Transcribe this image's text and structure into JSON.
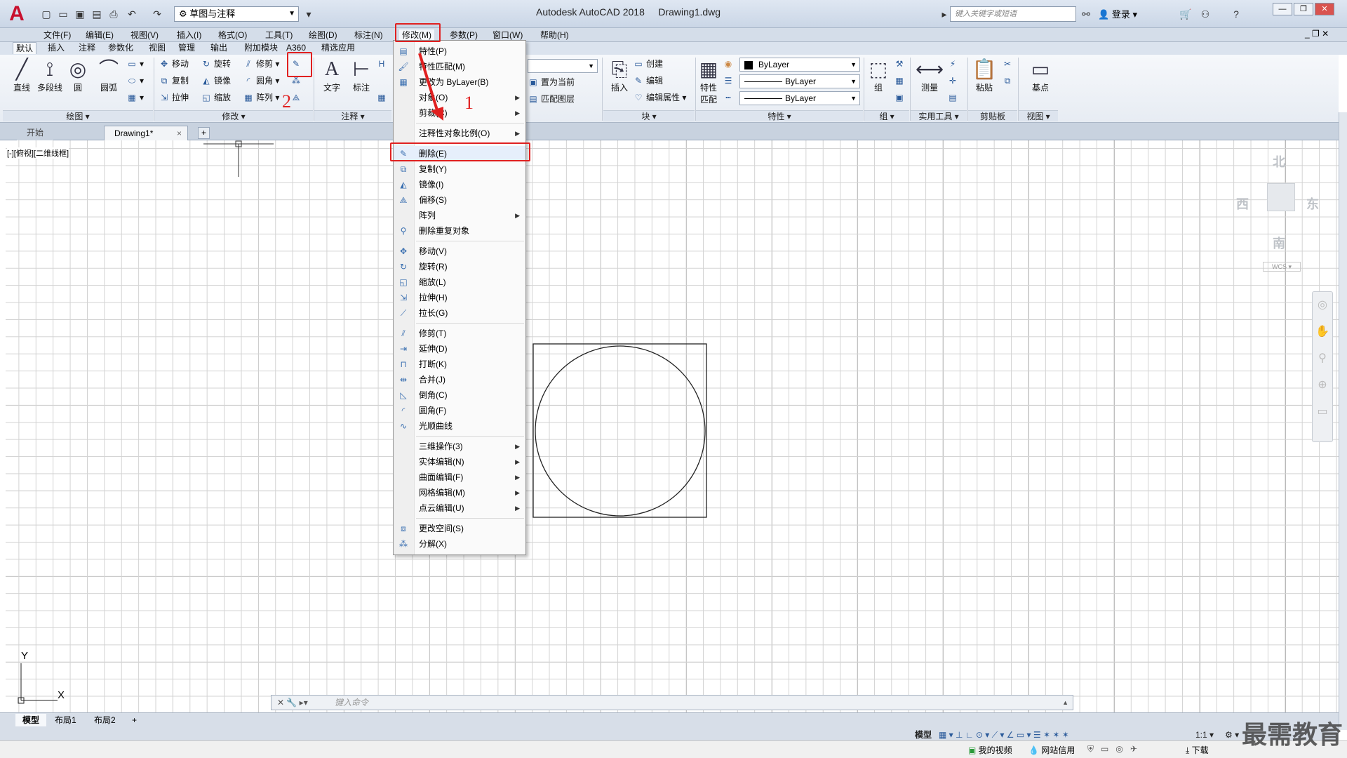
{
  "app": {
    "title": "Autodesk AutoCAD 2018",
    "document": "Drawing1.dwg",
    "logo": "A",
    "workspace": "草图与注释",
    "search_placeholder": "键入关键字或短语",
    "login": "登录"
  },
  "menubar": [
    "文件(F)",
    "编辑(E)",
    "视图(V)",
    "插入(I)",
    "格式(O)",
    "工具(T)",
    "绘图(D)",
    "标注(N)",
    "修改(M)",
    "参数(P)",
    "窗口(W)",
    "帮助(H)"
  ],
  "ribbon_tabs": [
    "默认",
    "插入",
    "注释",
    "参数化",
    "视图",
    "管理",
    "输出",
    "附加模块",
    "A360",
    "精选应用"
  ],
  "ribbon": {
    "draw": {
      "title": "绘图",
      "line": "直线",
      "polyline": "多段线",
      "circle": "圆",
      "arc": "圆弧"
    },
    "modify": {
      "title": "修改",
      "move": "移动",
      "rotate": "旋转",
      "trim": "修剪",
      "copy": "复制",
      "mirror": "镜像",
      "fillet": "圆角",
      "stretch": "拉伸",
      "scale": "缩放",
      "array": "阵列"
    },
    "annotation": {
      "title": "注释",
      "text": "文字",
      "dimension": "标注"
    },
    "layer": {
      "set_current": "置为当前",
      "match_layer": "匹配图层"
    },
    "block": {
      "title": "块",
      "insert": "插入",
      "create": "创建",
      "edit": "编辑",
      "edit_attr": "编辑属性"
    },
    "properties": {
      "title": "特性",
      "match": "特性匹配",
      "match_l1": "特性",
      "match_l2": "匹配",
      "color": "ByLayer",
      "linetype": "ByLayer",
      "lineweight": "ByLayer"
    },
    "group": {
      "title": "组",
      "group": "组"
    },
    "utilities": {
      "title": "实用工具",
      "measure": "测量"
    },
    "clipboard": {
      "title": "剪贴板",
      "paste": "粘贴"
    },
    "view": {
      "title": "视图",
      "base": "基点"
    }
  },
  "doctabs": {
    "start": "开始",
    "drawing": "Drawing1*",
    "close": "×",
    "add": "+"
  },
  "viewport_label": "[-][俯视][二维线框]",
  "viewcube": {
    "north": "北",
    "south": "南",
    "east": "东",
    "west": "西",
    "wcs": "WCS"
  },
  "ucs": {
    "x": "X",
    "y": "Y"
  },
  "command_placeholder": "键入命令",
  "layout_tabs": [
    "模型",
    "布局1",
    "布局2"
  ],
  "status": {
    "model": "模型",
    "scale": "1:1"
  },
  "taskbar": {
    "video": "我的视频",
    "credit": "网站信用",
    "download": "下载"
  },
  "watermark": "最需教育",
  "annotations": {
    "step1": "1",
    "step2": "2"
  },
  "dropdown": [
    {
      "label": "特性(P)",
      "icon": "properties-icon",
      "glyph": "▤"
    },
    {
      "label": "特性匹配(M)",
      "icon": "match-properties-icon",
      "glyph": "🖌"
    },
    {
      "label": "更改为 ByLayer(B)",
      "icon": "bylayer-icon",
      "glyph": "▦"
    },
    {
      "label": "对象(O)",
      "sub": true
    },
    {
      "label": "剪裁(C)",
      "sub": true
    },
    {
      "sep": true
    },
    {
      "label": "注释性对象比例(O)",
      "sub": true
    },
    {
      "sep": true
    },
    {
      "label": "删除(E)",
      "icon": "erase-icon",
      "glyph": "✎",
      "highlight": true
    },
    {
      "label": "复制(Y)",
      "icon": "copy-icon",
      "glyph": "⧉"
    },
    {
      "label": "镜像(I)",
      "icon": "mirror-icon",
      "glyph": "◭"
    },
    {
      "label": "偏移(S)",
      "icon": "offset-icon",
      "glyph": "⟁"
    },
    {
      "label": "阵列",
      "sub": true
    },
    {
      "label": "删除重复对象",
      "icon": "overkill-icon",
      "glyph": "⚲"
    },
    {
      "sep": true
    },
    {
      "label": "移动(V)",
      "icon": "move-icon",
      "glyph": "✥"
    },
    {
      "label": "旋转(R)",
      "icon": "rotate-icon",
      "glyph": "↻"
    },
    {
      "label": "缩放(L)",
      "icon": "scale-icon",
      "glyph": "◱"
    },
    {
      "label": "拉伸(H)",
      "icon": "stretch-icon",
      "glyph": "⇲"
    },
    {
      "label": "拉长(G)",
      "icon": "lengthen-icon",
      "glyph": "⟋"
    },
    {
      "sep": true
    },
    {
      "label": "修剪(T)",
      "icon": "trim-icon",
      "glyph": "⫽"
    },
    {
      "label": "延伸(D)",
      "icon": "extend-icon",
      "glyph": "⇥"
    },
    {
      "label": "打断(K)",
      "icon": "break-icon",
      "glyph": "⊓"
    },
    {
      "label": "合并(J)",
      "icon": "join-icon",
      "glyph": "⇹"
    },
    {
      "label": "倒角(C)",
      "icon": "chamfer-icon",
      "glyph": "◺"
    },
    {
      "label": "圆角(F)",
      "icon": "fillet-icon",
      "glyph": "◜"
    },
    {
      "label": "光顺曲线",
      "icon": "blend-icon",
      "glyph": "∿"
    },
    {
      "sep": true
    },
    {
      "label": "三维操作(3)",
      "sub": true
    },
    {
      "label": "实体编辑(N)",
      "sub": true
    },
    {
      "label": "曲面编辑(F)",
      "sub": true
    },
    {
      "label": "网格编辑(M)",
      "sub": true
    },
    {
      "label": "点云编辑(U)",
      "sub": true
    },
    {
      "sep": true
    },
    {
      "label": "更改空间(S)",
      "icon": "change-space-icon",
      "glyph": "⧈"
    },
    {
      "label": "分解(X)",
      "icon": "explode-icon",
      "glyph": "⁂"
    }
  ]
}
